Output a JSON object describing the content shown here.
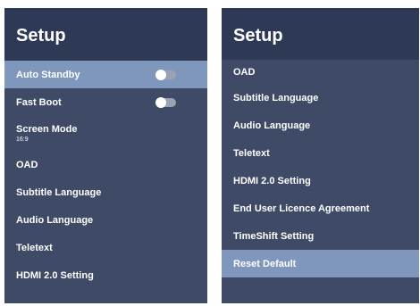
{
  "left_panel": {
    "title": "Setup",
    "items": [
      {
        "label": "Auto Standby",
        "highlighted": true,
        "toggle": "off"
      },
      {
        "label": "Fast Boot",
        "highlighted": false,
        "toggle": "off"
      },
      {
        "label": "Screen Mode",
        "value": "16:9"
      },
      {
        "label": "OAD"
      },
      {
        "label": "Subtitle Language"
      },
      {
        "label": "Audio Language"
      },
      {
        "label": "Teletext"
      },
      {
        "label": "HDMI 2.0 Setting"
      }
    ]
  },
  "right_panel": {
    "title": "Setup",
    "items": [
      {
        "label": "OAD"
      },
      {
        "label": "Subtitle Language"
      },
      {
        "label": "Audio Language"
      },
      {
        "label": "Teletext"
      },
      {
        "label": "HDMI 2.0 Setting"
      },
      {
        "label": "End User Licence Agreement"
      },
      {
        "label": "TimeShift Setting"
      },
      {
        "label": "Reset Default",
        "highlighted": true
      }
    ]
  },
  "colors": {
    "panel_bg": "#3e4a66",
    "header_bg": "#2e3a55",
    "highlight": "#7f97bc",
    "text": "#ffffff"
  }
}
